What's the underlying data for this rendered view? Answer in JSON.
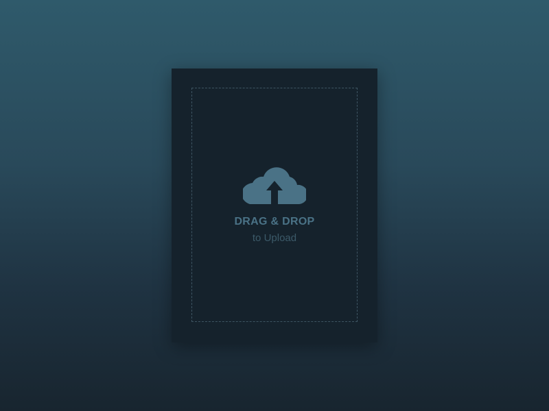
{
  "theme": {
    "background_top": "#2f5a6b",
    "background_bottom": "#18252f",
    "card_background": "#15222c",
    "dashed_border": "#3e5563",
    "accent": "#4a7286",
    "subtle_text": "#3c5a69"
  },
  "drop_zone": {
    "icon": "cloud-upload-icon",
    "title": "DRAG & DROP",
    "subtitle": "to Upload"
  }
}
